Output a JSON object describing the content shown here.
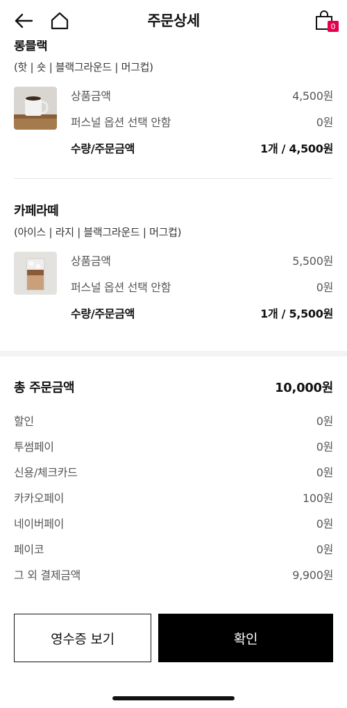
{
  "header": {
    "title": "주문상세",
    "cart_count": "0"
  },
  "items": [
    {
      "name": "롱블랙",
      "options": "(핫 | 숏 | 블랙그라운드 | 머그컵)",
      "price_label": "상품금액",
      "price": "4,500원",
      "option_label": "퍼스널 옵션 선택 안함",
      "option_price": "0원",
      "qty_label": "수량/주문금액",
      "qty_amount": "1개  / 4,500원"
    },
    {
      "name": "카페라떼",
      "options": "(아이스 | 라지 | 블랙그라운드 | 머그컵)",
      "price_label": "상품금액",
      "price": "5,500원",
      "option_label": "퍼스널 옵션 선택 안함",
      "option_price": "0원",
      "qty_label": "수량/주문금액",
      "qty_amount": "1개  / 5,500원"
    }
  ],
  "summary": {
    "total_label": "총 주문금액",
    "total_value": "10,000원",
    "rows": [
      {
        "label": "할인",
        "value": "0원"
      },
      {
        "label": "투썸페이",
        "value": "0원"
      },
      {
        "label": "신용/체크카드",
        "value": "0원"
      },
      {
        "label": "카카오페이",
        "value": "100원"
      },
      {
        "label": "네이버페이",
        "value": "0원"
      },
      {
        "label": "페이코",
        "value": "0원"
      },
      {
        "label": "그 외 결제금액",
        "value": "9,900원"
      }
    ]
  },
  "buttons": {
    "receipt": "영수증 보기",
    "confirm": "확인"
  },
  "colors": {
    "accent": "#e5004f",
    "primary_button": "#000000"
  },
  "icons": [
    "back-arrow-icon",
    "home-icon",
    "shopping-bag-icon"
  ]
}
